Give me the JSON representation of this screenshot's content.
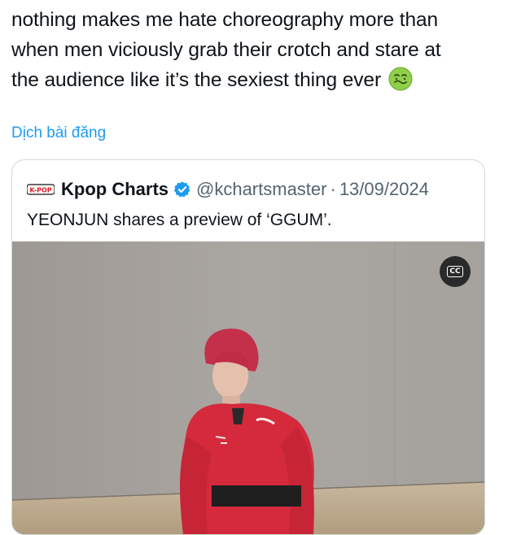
{
  "post": {
    "lines": [
      "nothing makes me hate choreography more than",
      "when men viciously grab their crotch and stare at",
      "the audience like it’s the sexiest thing ever"
    ],
    "emoji": "nauseated-face-icon",
    "translate_label": "Dịch bài đăng"
  },
  "quote": {
    "logo_text": "K-POP",
    "author": "Kpop Charts",
    "handle": "@kchartsmaster",
    "separator": "·",
    "date": "13/09/2024",
    "text": "YEONJUN shares a preview of ‘GGUM’.",
    "cc_label": "CC"
  },
  "colors": {
    "link": "#1d9bf0",
    "verified": "#1d9bf0",
    "text": "#0f1419",
    "muted": "#536471",
    "border": "#cfd9de"
  }
}
